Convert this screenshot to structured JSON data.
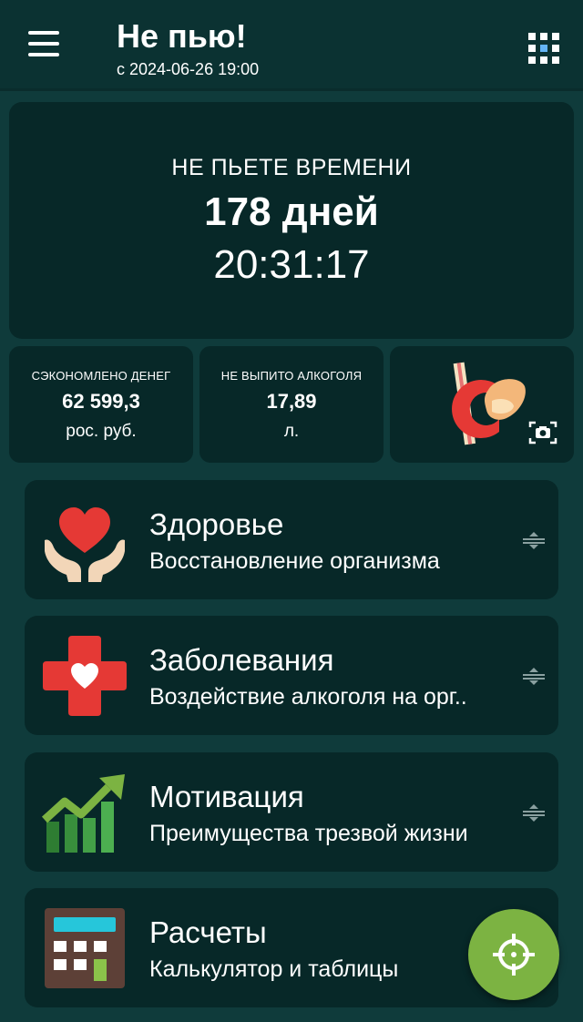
{
  "app": {
    "title": "Не пью!",
    "since": "с 2024-06-26 19:00"
  },
  "timer": {
    "label": "НЕ ПЬЕТЕ ВРЕМЕНИ",
    "days": "178 дней",
    "clock": "20:31:17"
  },
  "stats": {
    "money": {
      "caption": "СЭКОНОМЛЕНО ДЕНЕГ",
      "value": "62 599,3",
      "unit": "рос. руб."
    },
    "alcohol": {
      "caption": "НЕ ВЫПИТО АЛКОГОЛЯ",
      "value": "17,89",
      "unit": "л."
    }
  },
  "menu": [
    {
      "title": "Здоровье",
      "description": "Восстановление организма",
      "icon": "hands-heart-icon"
    },
    {
      "title": "Заболевания",
      "description": "Воздействие алкоголя на орг..",
      "icon": "medical-cross-icon"
    },
    {
      "title": "Мотивация",
      "description": "Преимущества трезвой жизни",
      "icon": "growth-chart-icon"
    },
    {
      "title": "Расчеты",
      "description": "Калькулятор и таблицы",
      "icon": "calculator-icon"
    }
  ],
  "colors": {
    "background": "#0f3b3b",
    "card": "#072828",
    "appbar": "#0b3232",
    "fab": "#7cb342",
    "heart_red": "#e53935",
    "chart_green": "#43a047"
  }
}
